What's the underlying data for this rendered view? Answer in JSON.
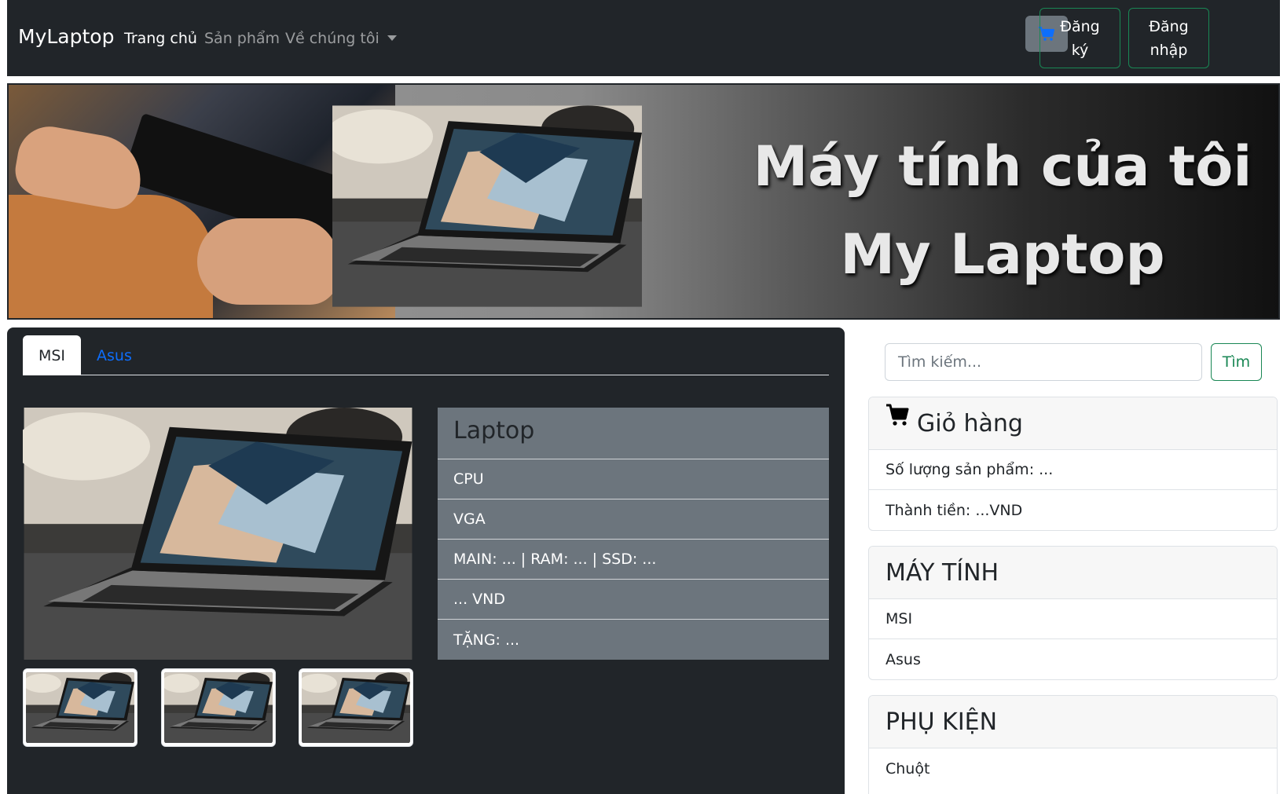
{
  "navbar": {
    "brand": "MyLaptop",
    "links": [
      {
        "label": "Trang chủ"
      },
      {
        "label": "Sản phẩm"
      },
      {
        "label": "Về chúng tôi"
      }
    ],
    "register_label": "Đăng ký",
    "login_label": "Đăng nhập",
    "cart_icon": "cart-icon"
  },
  "banner": {
    "line1": "Máy tính của tôi",
    "line2": "My Laptop"
  },
  "product": {
    "tabs": [
      "MSI",
      "Asus"
    ],
    "title": "Laptop",
    "specs": [
      "CPU",
      "VGA",
      "MAIN: ... | RAM: ... | SSD: ...",
      "... VND",
      "TẶNG: ..."
    ]
  },
  "search": {
    "placeholder": "Tìm kiếm...",
    "button_label": "Tìm"
  },
  "cart": {
    "title": "Giỏ hàng",
    "quantity_label": "Số lượng sản phẩm: ...",
    "total_label": "Thành tiền: ...VND"
  },
  "computers": {
    "title": "MÁY TÍNH",
    "items": [
      "MSI",
      "Asus"
    ]
  },
  "accessories": {
    "title": "PHỤ KIỆN",
    "items": [
      "Chuột"
    ]
  },
  "colors": {
    "dark": "#212529",
    "secondary": "#6c757d",
    "success": "#198754",
    "primary_link": "#0d6efd"
  }
}
